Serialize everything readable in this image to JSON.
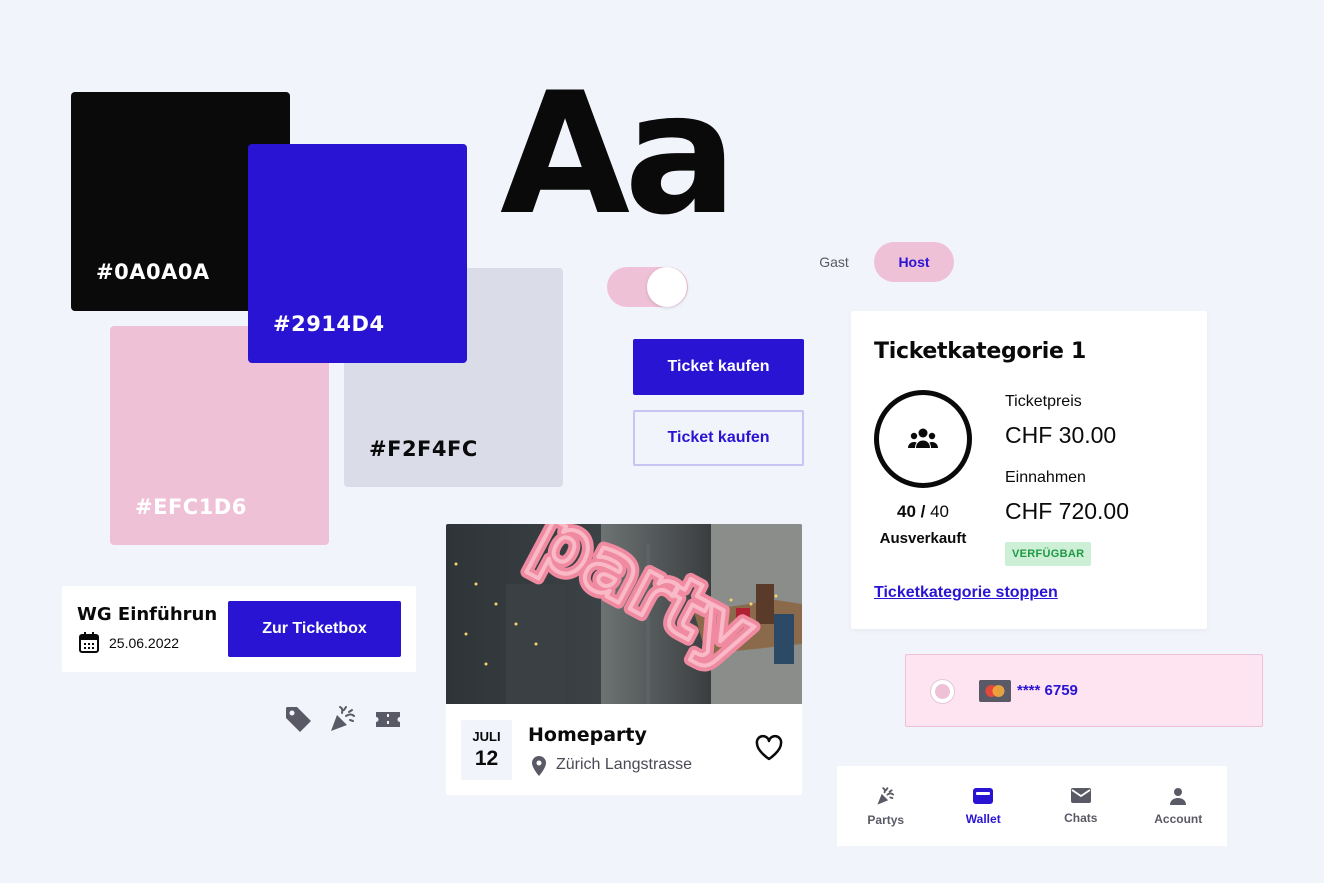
{
  "swatches": {
    "black": "#0A0A0A",
    "pink": "#EFC1D6",
    "grey": "#F2F4FC",
    "blue": "#2914D4"
  },
  "typography_sample": "Aa",
  "role_switch": {
    "gast": "Gast",
    "host": "Host",
    "selected": "Host"
  },
  "toggle_state": "on",
  "buttons": {
    "primary": "Ticket kaufen",
    "secondary": "Ticket kaufen"
  },
  "ticket_card": {
    "title": "Ticketkategorie 1",
    "sold": "40",
    "sold_sep": " / ",
    "total": "40",
    "status": "Ausverkauft",
    "price_label": "Ticketpreis",
    "price_value": "CHF 30.00",
    "revenue_label": "Einnahmen",
    "revenue_value": "CHF 720.00",
    "badge": "VERFÜGBAR",
    "stop_link": "Ticketkategorie stoppen"
  },
  "event_row": {
    "title": "WG Einführun...",
    "date": "25.06.2022",
    "cta": "Zur Ticketbox"
  },
  "icons": [
    "tag-icon",
    "party-popper-icon",
    "ticket-icon"
  ],
  "party_card": {
    "image_text": "party",
    "month": "JULI",
    "day": "12",
    "title": "Homeparty",
    "location": "Zürich Langstrasse"
  },
  "payment": {
    "card_number": "**** 6759"
  },
  "bottom_nav": [
    {
      "label": "Partys",
      "icon": "party-popper-icon",
      "active": false
    },
    {
      "label": "Wallet",
      "icon": "wallet-icon",
      "active": true
    },
    {
      "label": "Chats",
      "icon": "mail-icon",
      "active": false
    },
    {
      "label": "Account",
      "icon": "person-icon",
      "active": false
    }
  ],
  "colors": {
    "primary": "#2914D4",
    "accent": "#EFC1D6",
    "background": "#F2F4FC",
    "text": "#0A0A0A",
    "success": "#1F9A45"
  }
}
